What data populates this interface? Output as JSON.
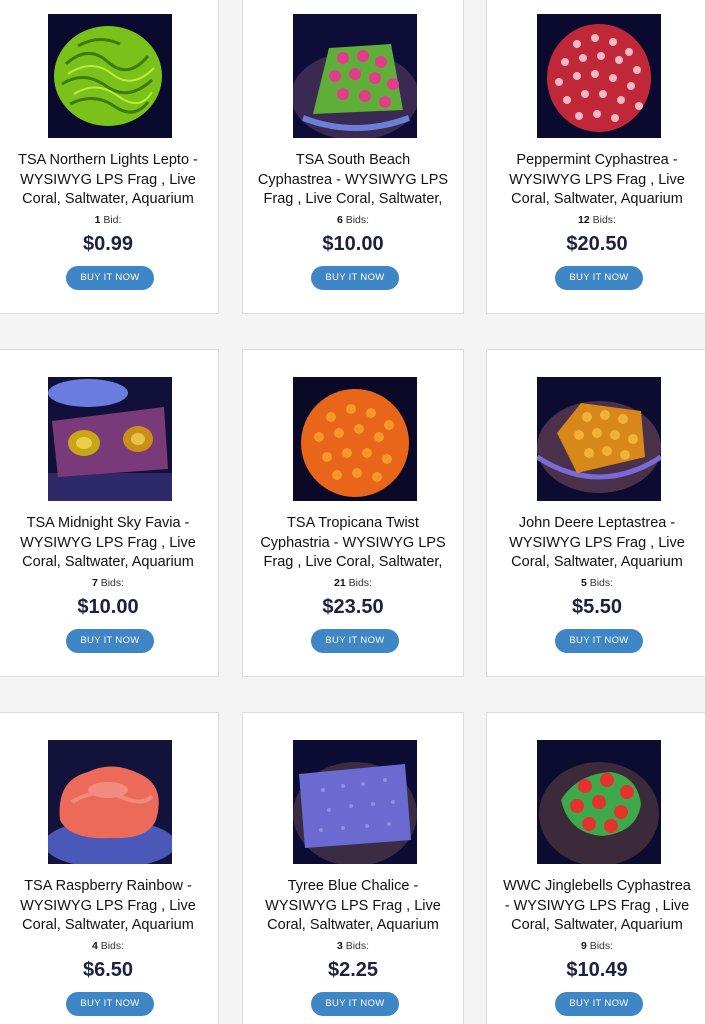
{
  "listings": [
    {
      "title": "TSA Northern Lights Lepto - WYSIWYG LPS Frag , Live Coral, Saltwater, Aquarium",
      "bid_count": "1",
      "bid_label": "Bid:",
      "price": "$0.99",
      "button": "BUY IT NOW"
    },
    {
      "title": "TSA South Beach Cyphastrea - WYSIWYG LPS Frag , Live Coral, Saltwater, Aquarium",
      "bid_count": "6",
      "bid_label": "Bids:",
      "price": "$10.00",
      "button": "BUY IT NOW"
    },
    {
      "title": "Peppermint Cyphastrea - WYSIWYG LPS Frag , Live Coral, Saltwater, Aquarium",
      "bid_count": "12",
      "bid_label": "Bids:",
      "price": "$20.50",
      "button": "BUY IT NOW"
    },
    {
      "title": "TSA Midnight Sky Favia - WYSIWYG LPS Frag , Live Coral, Saltwater, Aquarium",
      "bid_count": "7",
      "bid_label": "Bids:",
      "price": "$10.00",
      "button": "BUY IT NOW"
    },
    {
      "title": "TSA Tropicana Twist Cyphastria - WYSIWYG LPS Frag , Live Coral, Saltwater,",
      "bid_count": "21",
      "bid_label": "Bids:",
      "price": "$23.50",
      "button": "BUY IT NOW"
    },
    {
      "title": "John Deere Leptastrea - WYSIWYG LPS Frag , Live Coral, Saltwater, Aquarium",
      "bid_count": "5",
      "bid_label": "Bids:",
      "price": "$5.50",
      "button": "BUY IT NOW"
    },
    {
      "title": "TSA Raspberry Rainbow - WYSIWYG LPS Frag , Live Coral, Saltwater, Aquarium",
      "bid_count": "4",
      "bid_label": "Bids:",
      "price": "$6.50",
      "button": "BUY IT NOW"
    },
    {
      "title": "Tyree Blue Chalice - WYSIWYG LPS Frag , Live Coral, Saltwater, Aquarium",
      "bid_count": "3",
      "bid_label": "Bids:",
      "price": "$2.25",
      "button": "BUY IT NOW"
    },
    {
      "title": "WWC Jinglebells Cyphastrea - WYSIWYG LPS Frag , Live Coral, Saltwater, Aquarium",
      "bid_count": "9",
      "bid_label": "Bids:",
      "price": "$10.49",
      "button": "BUY IT NOW"
    }
  ],
  "colors": {
    "button_bg": "#3f86c6",
    "price_text": "#1c2140",
    "page_bg": "#f4f4f4",
    "card_border": "#dcdcdc"
  }
}
